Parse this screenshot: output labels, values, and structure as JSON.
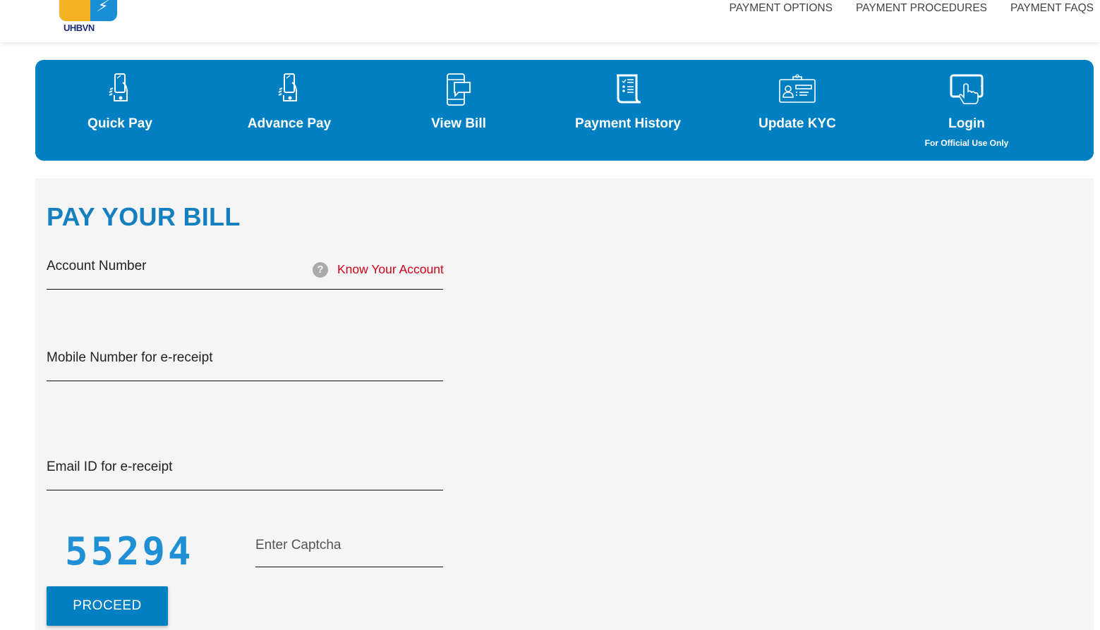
{
  "header": {
    "logo_text": "UHBVN",
    "nav": [
      {
        "label": "PAYMENT OPTIONS"
      },
      {
        "label": "PAYMENT PROCEDURES"
      },
      {
        "label": "PAYMENT FAQS"
      }
    ]
  },
  "services": [
    {
      "label": "Quick Pay",
      "icon": "phone-in-hand-icon"
    },
    {
      "label": "Advance Pay",
      "icon": "phone-in-hand-icon"
    },
    {
      "label": "View Bill",
      "icon": "phone-message-icon"
    },
    {
      "label": "Payment History",
      "icon": "scroll-list-icon"
    },
    {
      "label": "Update KYC",
      "icon": "id-card-icon"
    },
    {
      "label": "Login",
      "sublabel": "For Official Use Only",
      "icon": "tablet-touch-icon"
    }
  ],
  "form": {
    "title": "PAY YOUR BILL",
    "account_label": "Account Number",
    "account_value": "",
    "help_icon": "?",
    "know_account_link": "Know Your Account",
    "mobile_label": "Mobile Number for e-receipt",
    "mobile_value": "",
    "email_label": "Email ID for e-receipt",
    "email_value": "",
    "captcha_code": "55294",
    "captcha_label": "Enter Captcha",
    "captcha_value": "",
    "proceed_label": "PROCEED"
  },
  "colors": {
    "brand_blue": "#0080c3",
    "title_blue": "#1580bf",
    "link_red": "#d0021b",
    "panel_bg": "#f5f5f5"
  }
}
